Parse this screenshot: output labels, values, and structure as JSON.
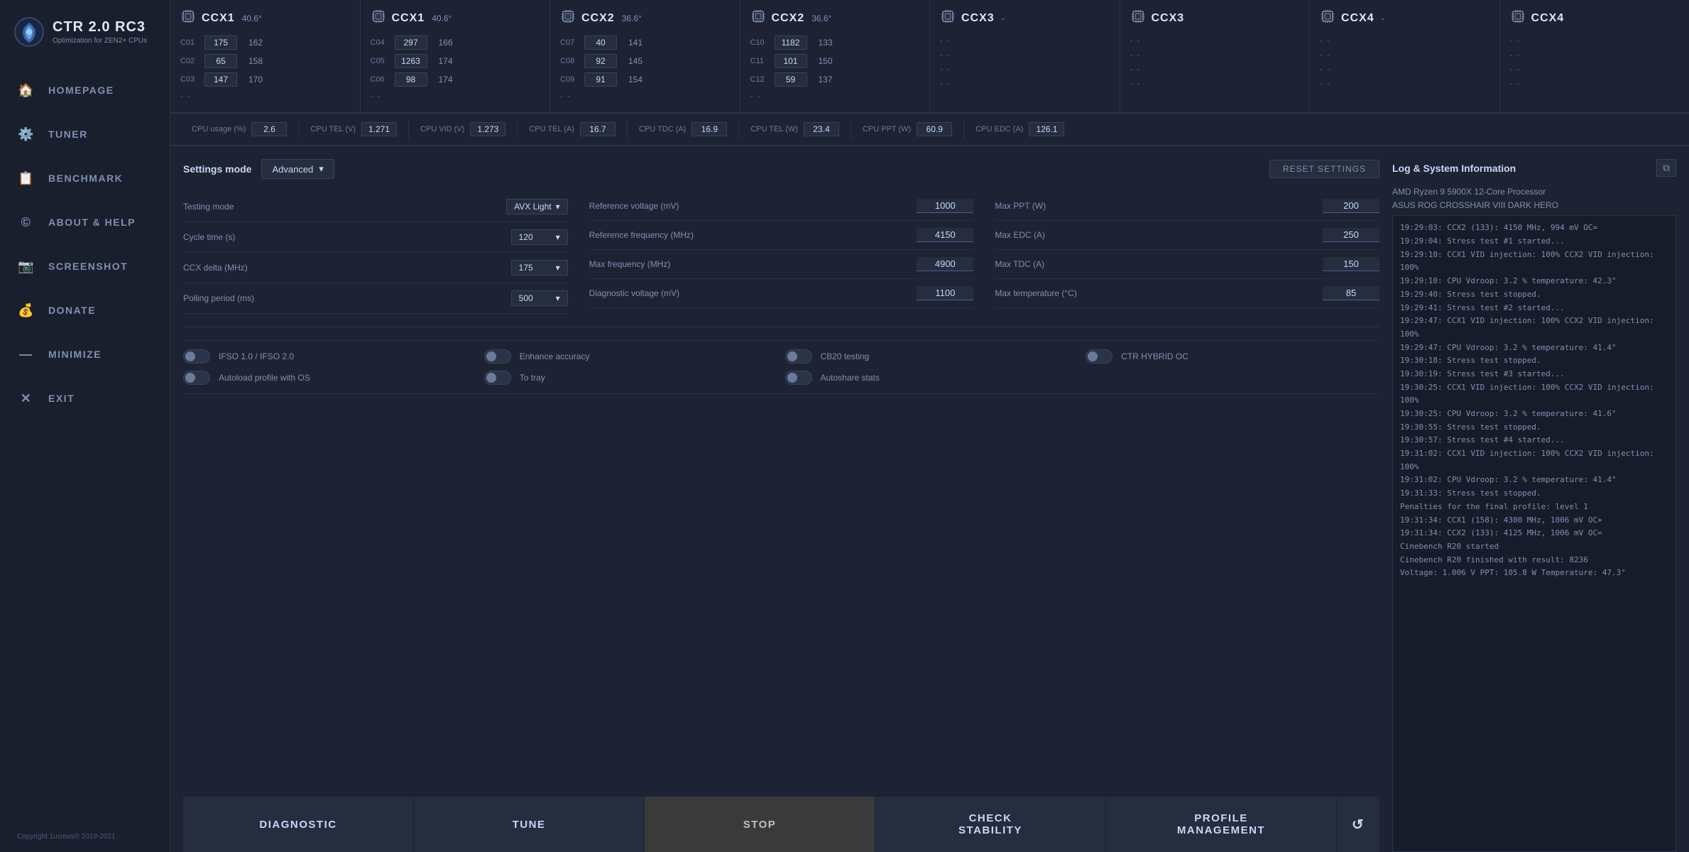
{
  "app": {
    "title": "CTR 2.0 RC3",
    "subtitle": "Optimization for ZEN2+ CPUs",
    "copyright": "Copyright 1usmus© 2019-2021"
  },
  "sidebar": {
    "items": [
      {
        "id": "homepage",
        "label": "HOMEPAGE",
        "icon": "🏠"
      },
      {
        "id": "tuner",
        "label": "TUNER",
        "icon": "⚙️"
      },
      {
        "id": "benchmark",
        "label": "BENCHMARK",
        "icon": "📋"
      },
      {
        "id": "about",
        "label": "ABOUT & HELP",
        "icon": "©"
      },
      {
        "id": "screenshot",
        "label": "SCREENSHOT",
        "icon": "📷"
      },
      {
        "id": "donate",
        "label": "DONATE",
        "icon": "💰"
      },
      {
        "id": "minimize",
        "label": "MINIMIZE",
        "icon": "—"
      },
      {
        "id": "exit",
        "label": "EXIT",
        "icon": "✕"
      }
    ]
  },
  "cpu_panels": [
    {
      "id": "ccx1a",
      "title": "CCX1",
      "temp": "40.6°",
      "cores": [
        {
          "label": "C01",
          "val1": "175",
          "val2": "162"
        },
        {
          "label": "C02",
          "val1": "65",
          "val2": "158"
        },
        {
          "label": "C03",
          "val1": "147",
          "val2": "170"
        },
        {
          "label": "-",
          "val1": "-",
          "val2": ""
        }
      ]
    },
    {
      "id": "ccx1b",
      "title": "CCX1",
      "temp": "40.6°",
      "cores": [
        {
          "label": "C04",
          "val1": "297",
          "val2": "166"
        },
        {
          "label": "C05",
          "val1": "1263",
          "val2": "174"
        },
        {
          "label": "C06",
          "val1": "98",
          "val2": "174"
        },
        {
          "label": "-",
          "val1": "-",
          "val2": ""
        }
      ]
    },
    {
      "id": "ccx2a",
      "title": "CCX2",
      "temp": "36.6°",
      "cores": [
        {
          "label": "C07",
          "val1": "40",
          "val2": "141"
        },
        {
          "label": "C08",
          "val1": "92",
          "val2": "145"
        },
        {
          "label": "C09",
          "val1": "91",
          "val2": "154"
        },
        {
          "label": "-",
          "val1": "-",
          "val2": ""
        }
      ]
    },
    {
      "id": "ccx2b",
      "title": "CCX2",
      "temp": "36.6°",
      "cores": [
        {
          "label": "C10",
          "val1": "1182",
          "val2": "133"
        },
        {
          "label": "C11",
          "val1": "101",
          "val2": "150"
        },
        {
          "label": "C12",
          "val1": "59",
          "val2": "137"
        },
        {
          "label": "-",
          "val1": "-",
          "val2": ""
        }
      ]
    },
    {
      "id": "ccx3a",
      "title": "CCX3",
      "temp": "-",
      "cores": [
        {
          "label": "-",
          "val1": "-",
          "val2": ""
        },
        {
          "label": "-",
          "val1": "-",
          "val2": ""
        },
        {
          "label": "-",
          "val1": "-",
          "val2": ""
        },
        {
          "label": "-",
          "val1": "-",
          "val2": ""
        }
      ]
    },
    {
      "id": "ccx3b",
      "title": "CCX3",
      "temp": "",
      "cores": [
        {
          "label": "-",
          "val1": "-",
          "val2": ""
        },
        {
          "label": "-",
          "val1": "-",
          "val2": ""
        },
        {
          "label": "-",
          "val1": "-",
          "val2": ""
        },
        {
          "label": "-",
          "val1": "-",
          "val2": ""
        }
      ]
    },
    {
      "id": "ccx4a",
      "title": "CCX4",
      "temp": "-",
      "cores": [
        {
          "label": "-",
          "val1": "-",
          "val2": ""
        },
        {
          "label": "-",
          "val1": "-",
          "val2": ""
        },
        {
          "label": "-",
          "val1": "-",
          "val2": ""
        },
        {
          "label": "-",
          "val1": "-",
          "val2": ""
        }
      ]
    },
    {
      "id": "ccx4b",
      "title": "CCX4",
      "temp": "",
      "cores": [
        {
          "label": "-",
          "val1": "-",
          "val2": ""
        },
        {
          "label": "-",
          "val1": "-",
          "val2": ""
        },
        {
          "label": "-",
          "val1": "-",
          "val2": ""
        },
        {
          "label": "-",
          "val1": "-",
          "val2": ""
        }
      ]
    }
  ],
  "status_bar": [
    {
      "label": "CPU usage (%)",
      "value": "2.6"
    },
    {
      "label": "CPU TEL (V)",
      "value": "1.271"
    },
    {
      "label": "CPU VID (V)",
      "value": "1.273"
    },
    {
      "label": "CPU TEL (A)",
      "value": "16.7"
    },
    {
      "label": "CPU TDC (A)",
      "value": "16.9"
    },
    {
      "label": "CPU TEL (W)",
      "value": "23.4"
    },
    {
      "label": "CPU PPT (W)",
      "value": "60.9"
    },
    {
      "label": "CPU EDC (A)",
      "value": "126.1"
    }
  ],
  "settings": {
    "mode_label": "Settings mode",
    "mode_value": "Advanced",
    "reset_label": "RESET SETTINGS",
    "fields_col1": [
      {
        "label": "Testing mode",
        "value": "AVX Light",
        "type": "dropdown"
      },
      {
        "label": "Cycle time (s)",
        "value": "120",
        "type": "dropdown"
      },
      {
        "label": "CCX delta (MHz)",
        "value": "175",
        "type": "dropdown"
      },
      {
        "label": "Polling period (ms)",
        "value": "500",
        "type": "dropdown"
      }
    ],
    "fields_col2": [
      {
        "label": "Reference voltage (mV)",
        "value": "1000",
        "type": "input"
      },
      {
        "label": "Reference frequency (MHz)",
        "value": "4150",
        "type": "input"
      },
      {
        "label": "Max frequency (MHz)",
        "value": "4900",
        "type": "input"
      },
      {
        "label": "Diagnostic voltage (mV)",
        "value": "1100",
        "type": "input"
      }
    ],
    "fields_col3": [
      {
        "label": "Max PPT (W)",
        "value": "200",
        "type": "input"
      },
      {
        "label": "Max EDC (A)",
        "value": "250",
        "type": "input"
      },
      {
        "label": "Max TDC (A)",
        "value": "150",
        "type": "input"
      },
      {
        "label": "Max temperature (°C)",
        "value": "85",
        "type": "input"
      }
    ],
    "toggles": [
      {
        "label": "IFSO 1.0 / IFSO 2.0",
        "on": false
      },
      {
        "label": "Enhance accuracy",
        "on": false
      },
      {
        "label": "CB20 testing",
        "on": false
      },
      {
        "label": "CTR HYBRID OC",
        "on": false
      },
      {
        "label": "Autoload profile with OS",
        "on": false
      },
      {
        "label": "To tray",
        "on": false
      },
      {
        "label": "Autoshare stats",
        "on": false
      }
    ],
    "buttons": [
      {
        "id": "diagnostic",
        "label": "DIAGNOSTIC"
      },
      {
        "id": "tune",
        "label": "TUNE"
      },
      {
        "id": "stop",
        "label": "STOP"
      },
      {
        "id": "check_stability",
        "label": "CHECK\nSTABILITY"
      },
      {
        "id": "profile_management",
        "label": "PROFILE\nMANAGEMENT"
      },
      {
        "id": "refresh",
        "label": "↺"
      }
    ]
  },
  "log": {
    "title": "Log & System Information",
    "copy_icon": "⧉",
    "sysinfo": [
      "AMD Ryzen 9 5900X 12-Core Processor",
      "ASUS ROG CROSSHAIR VIII DARK HERO"
    ],
    "entries": [
      "19:29:03: CCX2 (133): 4150 MHz, 994 mV OC=",
      "19:29:04: Stress test #1 started...",
      "19:29:10: CCX1 VID injection: 100% CCX2 VID injection: 100%",
      "19:29:10: CPU Vdroop: 3.2 % temperature: 42.3°",
      "19:29:40: Stress test stopped.",
      "19:29:41: Stress test #2 started...",
      "19:29:47: CCX1 VID injection: 100% CCX2 VID injection: 100%",
      "19:29:47: CPU Vdroop: 3.2 % temperature: 41.4°",
      "19:30:18: Stress test stopped.",
      "19:30:19: Stress test #3 started...",
      "19:30:25: CCX1 VID injection: 100% CCX2 VID injection: 100%",
      "19:30:25: CPU Vdroop: 3.2 % temperature: 41.6°",
      "19:30:55: Stress test stopped.",
      "19:30:57: Stress test #4 started...",
      "19:31:02: CCX1 VID injection: 100% CCX2 VID injection: 100%",
      "19:31:02: CPU Vdroop: 3.2 % temperature: 41.4°",
      "19:31:33: Stress test stopped.",
      "Penalties for the final profile: level 1",
      "19:31:34: CCX1 (158): 4300 MHz, 1006 mV OC+",
      "19:31:34: CCX2 (133): 4125 MHz, 1006 mV OC=",
      "Cinebench R20 started",
      "Cinebench R20 finished with result: 8236",
      "Voltage: 1.006 V PPT: 105.8 W Temperature: 47.3°"
    ]
  }
}
